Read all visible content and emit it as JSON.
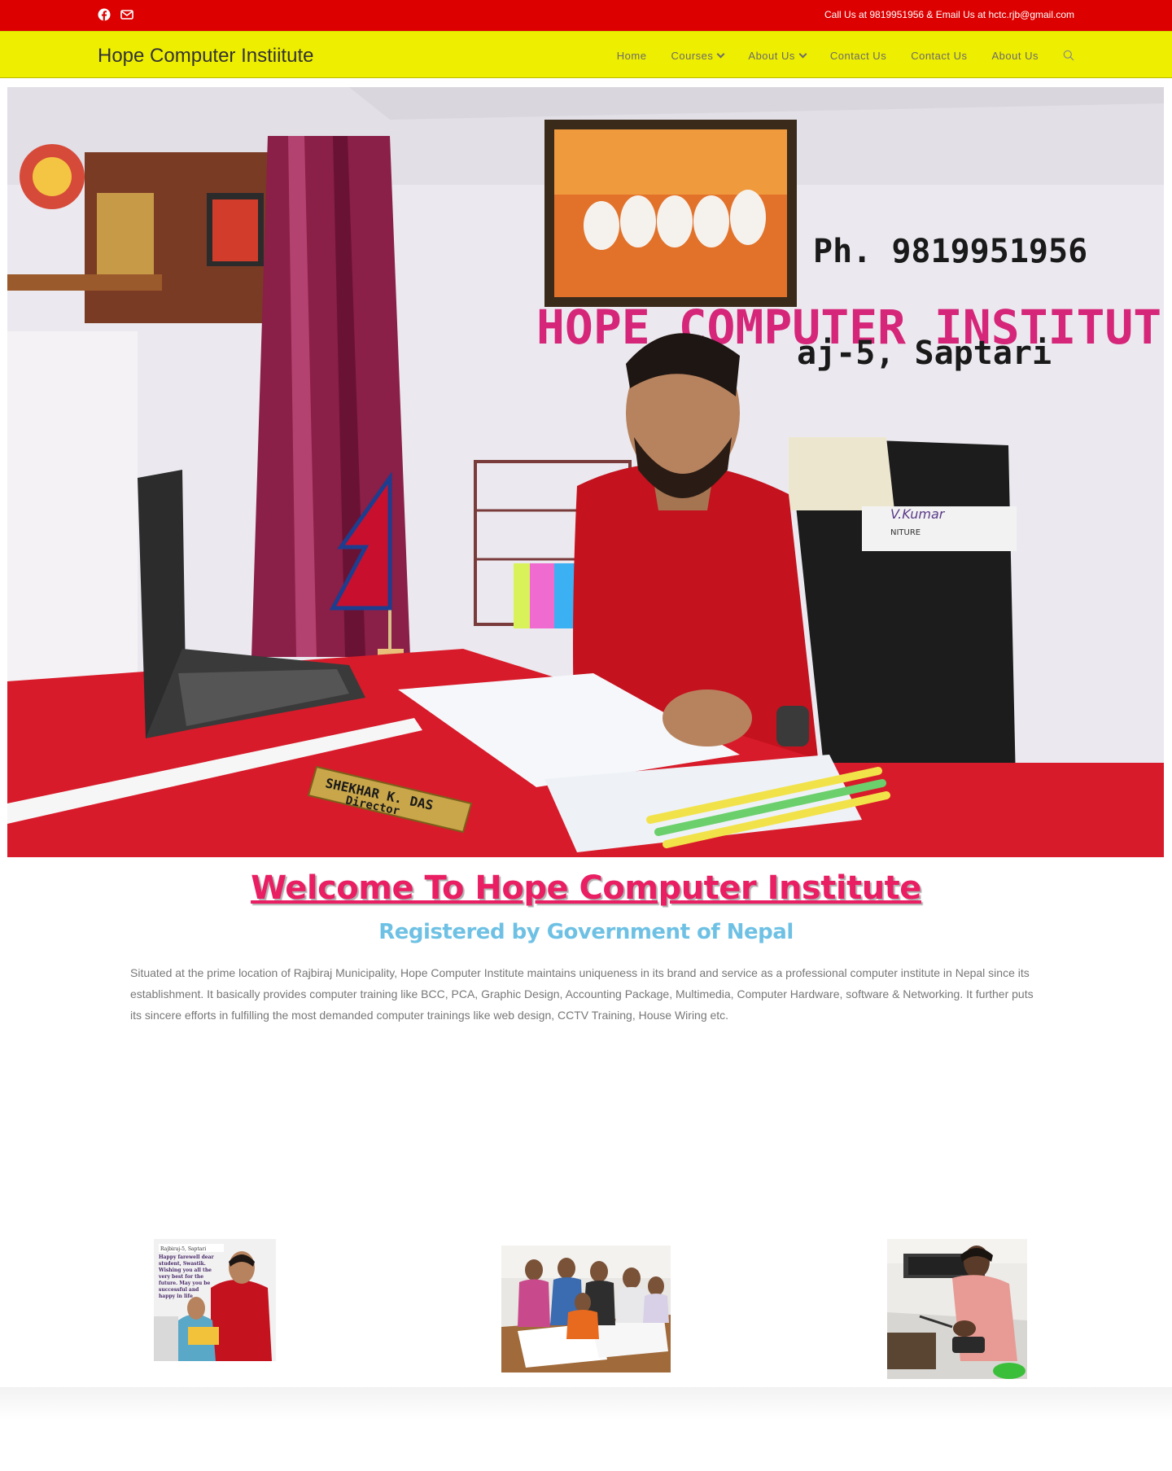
{
  "topbar": {
    "social": [
      {
        "icon": "facebook-icon"
      },
      {
        "icon": "mail-icon"
      }
    ],
    "contact_text": "Call Us at 9819951956 & Email Us at hctc.rjb@gmail.com"
  },
  "header": {
    "brand": "Hope Computer Instiitute",
    "nav": [
      {
        "label": "Home",
        "has_dropdown": false
      },
      {
        "label": "Courses",
        "has_dropdown": true
      },
      {
        "label": "About Us",
        "has_dropdown": true
      },
      {
        "label": "Contact Us",
        "has_dropdown": false
      },
      {
        "label": "Contact Us",
        "has_dropdown": false
      },
      {
        "label": "About Us",
        "has_dropdown": false
      }
    ],
    "search_icon": "search-icon"
  },
  "hero": {
    "sign_phone": "Ph. 9819951956",
    "sign_name": "HOPE COMPUTER INSTITUTE",
    "sign_address": "aj-5, Saptari",
    "nameplate_name": "SHEKHAR K. DAS",
    "nameplate_title": "Director",
    "chair_label": "V.Kumar",
    "chair_sub": "NITURE"
  },
  "main": {
    "title": "Welcome To Hope Computer Institute",
    "subtitle": "Registered by Government of Nepal",
    "intro": "Situated at the prime location of Rajbiraj Municipality, Hope Computer Institute maintains uniqueness in its brand and service as a professional computer institute in Nepal since its establishment. It basically provides computer training like BCC, PCA, Graphic Design, Accounting Package, Multimedia, Computer Hardware, software & Networking. It further puts its sincere efforts in fulfilling the most demanded computer trainings like web design, CCTV Training, House Wiring etc."
  },
  "gallery": {
    "card1_header": "Rajbiraj-5, Saptari",
    "card1_lines": [
      "Happy farewell dear",
      "student, Swastik.",
      "Wishing you all the",
      "very best for the",
      "future. May you be",
      "successful and",
      "happy in life"
    ]
  },
  "colors": {
    "topbar": "#dd0000",
    "header": "#eeee00",
    "title": "#e91e63",
    "subtitle": "#6ec1e4"
  }
}
